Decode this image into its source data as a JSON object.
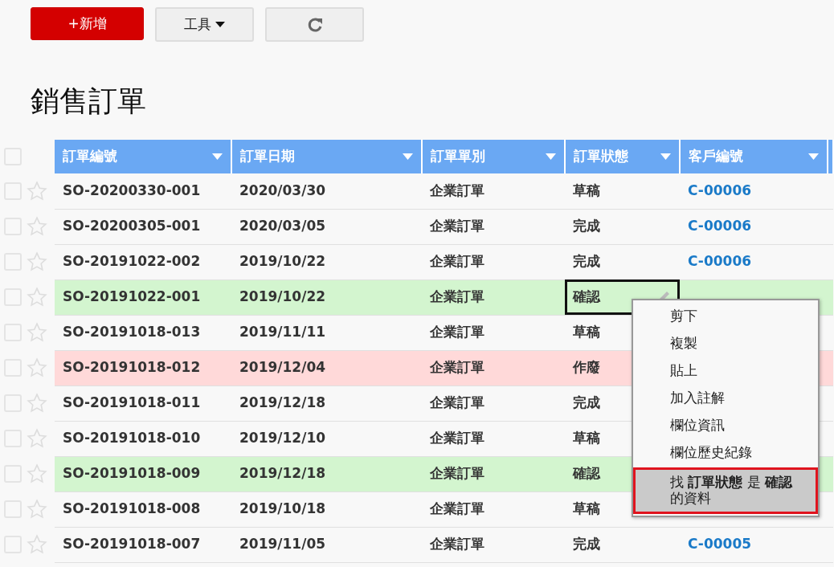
{
  "toolbar": {
    "add_button": "+新增",
    "tools_button": "工具"
  },
  "title": "銷售訂單",
  "table": {
    "header_checked": false,
    "columns": [
      "訂單編號",
      "訂單日期",
      "訂單單別",
      "訂單狀態",
      "客戶編號"
    ],
    "rows": [
      {
        "checked": false,
        "starred": false,
        "order_no": "SO-20200330-001",
        "date": "2020/03/30",
        "type": "企業訂單",
        "status": {
          "text": "草稿",
          "selected": false
        },
        "customer": "C-00006"
      },
      {
        "checked": false,
        "starred": false,
        "order_no": "SO-20200305-001",
        "date": "2020/03/05",
        "type": "企業訂單",
        "status": {
          "text": "完成",
          "selected": false
        },
        "customer": "C-00006"
      },
      {
        "checked": false,
        "starred": false,
        "order_no": "SO-20191022-002",
        "date": "2019/10/22",
        "type": "企業訂單",
        "status": {
          "text": "完成",
          "selected": false
        },
        "customer": "C-00006"
      },
      {
        "checked": false,
        "starred": false,
        "color": "#d3f5cf",
        "order_no": "SO-20191022-001",
        "date": "2019/10/22",
        "type": "企業訂單",
        "status": {
          "text": "確認",
          "selected": true
        }
      },
      {
        "checked": false,
        "starred": false,
        "order_no": "SO-20191018-013",
        "date": "2019/11/11",
        "type": "企業訂單",
        "status": {
          "text": "草稿",
          "selected": false
        }
      },
      {
        "checked": false,
        "starred": false,
        "color": "#ffd9d9",
        "order_no": "SO-20191018-012",
        "date": "2019/12/04",
        "type": "企業訂單",
        "status": {
          "text": "作廢",
          "selected": false
        }
      },
      {
        "checked": false,
        "starred": false,
        "order_no": "SO-20191018-011",
        "date": "2019/12/18",
        "type": "企業訂單",
        "status": {
          "text": "完成",
          "selected": false
        }
      },
      {
        "checked": false,
        "starred": false,
        "order_no": "SO-20191018-010",
        "date": "2019/12/10",
        "type": "企業訂單",
        "status": {
          "text": "草稿",
          "selected": false
        }
      },
      {
        "checked": false,
        "starred": false,
        "color": "#d3f5cf",
        "order_no": "SO-20191018-009",
        "date": "2019/12/18",
        "type": "企業訂單",
        "status": {
          "text": "確認",
          "selected": false
        }
      },
      {
        "checked": false,
        "starred": false,
        "order_no": "SO-20191018-008",
        "date": "2019/10/18",
        "type": "企業訂單",
        "status": {
          "text": "草稿",
          "selected": false
        }
      },
      {
        "checked": false,
        "starred": false,
        "order_no": "SO-20191018-007",
        "date": "2019/11/05",
        "type": "企業訂單",
        "status": {
          "text": "完成",
          "selected": false
        },
        "customer": "C-00005"
      }
    ]
  },
  "context_menu": [
    {
      "label": "剪下",
      "selected": false
    },
    {
      "label": "複製",
      "selected": false
    },
    {
      "label": "貼上",
      "selected": false
    },
    {
      "label": "加入註解",
      "selected": false
    },
    {
      "label": "欄位資訊",
      "selected": false
    },
    {
      "label": "欄位歷史紀錄",
      "selected": false
    },
    {
      "label": "找 **訂單狀態** 是 **確認**的資料",
      "selected": true
    }
  ]
}
